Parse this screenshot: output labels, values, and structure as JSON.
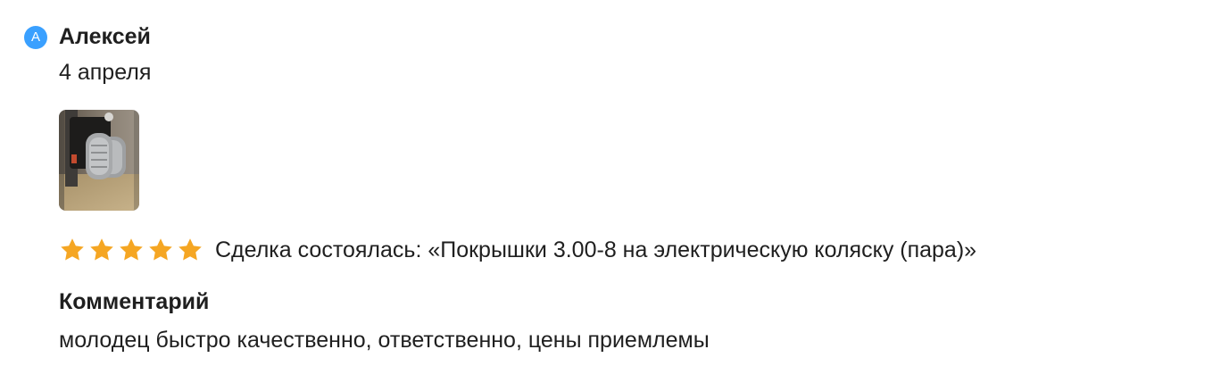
{
  "review": {
    "avatar_letter": "А",
    "author": "Алексей",
    "date": "4 апреля",
    "photo_icon": "wheel-photo",
    "rating": 5,
    "rating_max": 5,
    "star_color": "#f5a623",
    "deal_text": "Сделка состоялась: «Покрышки 3.00-8 на электрическую коляску (пара)»",
    "comment_title": "Комментарий",
    "comment_text": "молодец быстро качественно, ответственно, цены приемлемы"
  },
  "colors": {
    "avatar_bg": "#3aa0ff",
    "text": "#1f1f1f"
  }
}
